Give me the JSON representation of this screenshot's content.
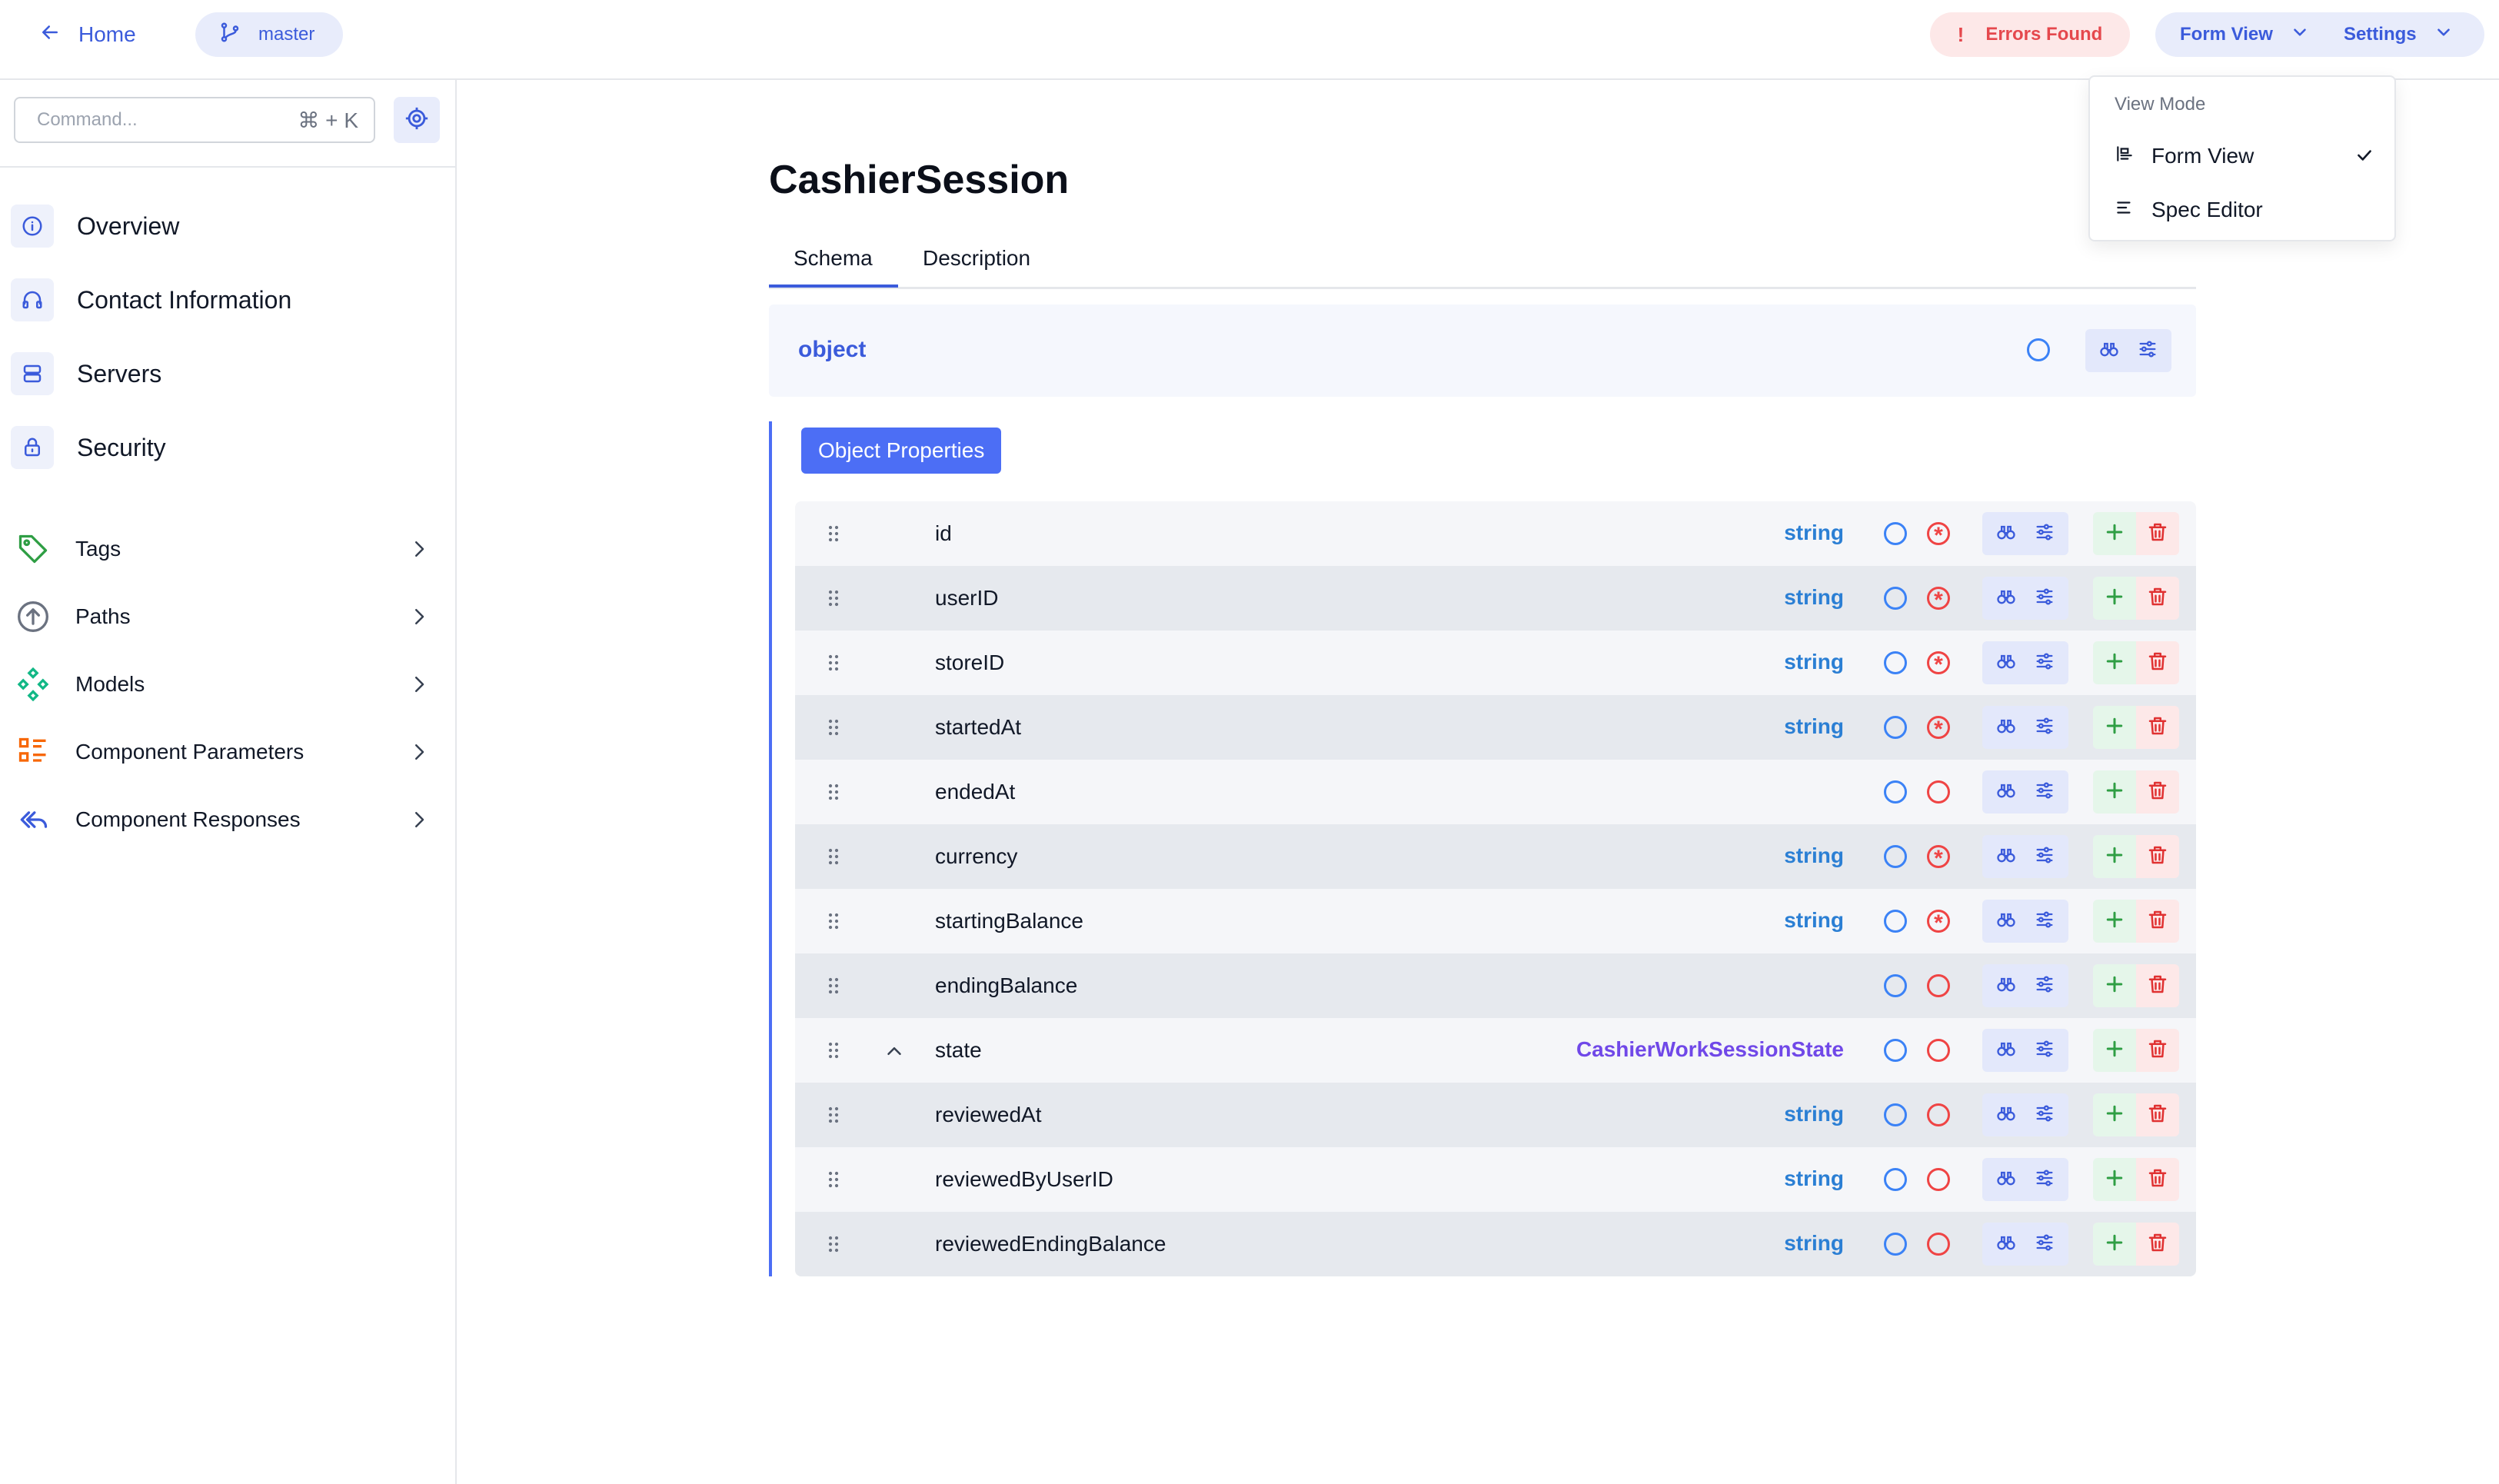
{
  "topbar": {
    "home_label": "Home",
    "branch_label": "master",
    "errors_label": "Errors Found",
    "errors_icon": "!",
    "view_label": "Form View",
    "settings_label": "Settings"
  },
  "sidebar": {
    "command_placeholder": "Command...",
    "command_shortcut": "⌘ + K",
    "nav_items": [
      {
        "label": "Overview",
        "icon": "info-icon"
      },
      {
        "label": "Contact Information",
        "icon": "headphones-icon"
      },
      {
        "label": "Servers",
        "icon": "server-icon"
      },
      {
        "label": "Security",
        "icon": "lock-icon"
      }
    ],
    "sections": [
      {
        "label": "Tags",
        "icon": "tag-icon"
      },
      {
        "label": "Paths",
        "icon": "arrow-up-circle-icon"
      },
      {
        "label": "Models",
        "icon": "models-icon"
      },
      {
        "label": "Component Parameters",
        "icon": "list-icon"
      },
      {
        "label": "Component Responses",
        "icon": "reply-icon"
      }
    ]
  },
  "main": {
    "title": "CashierSession",
    "tabs": [
      {
        "label": "Schema",
        "active": true
      },
      {
        "label": "Description",
        "active": false
      }
    ],
    "object_type": "object",
    "properties_label": "Object Properties",
    "properties": [
      {
        "name": "id",
        "type": "string",
        "required": true
      },
      {
        "name": "userID",
        "type": "string",
        "required": true
      },
      {
        "name": "storeID",
        "type": "string",
        "required": true
      },
      {
        "name": "startedAt",
        "type": "string",
        "required": true
      },
      {
        "name": "endedAt",
        "type": "",
        "required": false
      },
      {
        "name": "currency",
        "type": "string",
        "required": true
      },
      {
        "name": "startingBalance",
        "type": "string",
        "required": true
      },
      {
        "name": "endingBalance",
        "type": "",
        "required": false
      },
      {
        "name": "state",
        "type": "CashierWorkSessionState",
        "required": false,
        "expandable": true
      },
      {
        "name": "reviewedAt",
        "type": "string",
        "required": false
      },
      {
        "name": "reviewedByUserID",
        "type": "string",
        "required": false
      },
      {
        "name": "reviewedEndingBalance",
        "type": "string",
        "required": false
      }
    ]
  },
  "dropdown": {
    "header": "View Mode",
    "options": [
      {
        "label": "Form View",
        "selected": true
      },
      {
        "label": "Spec Editor",
        "selected": false
      }
    ]
  },
  "colors": {
    "accent": "#3b5bdb",
    "type_string": "#2b7fd4",
    "type_ref": "#7048e8",
    "required": "#ef4444",
    "error_bg": "#fde8e8"
  }
}
